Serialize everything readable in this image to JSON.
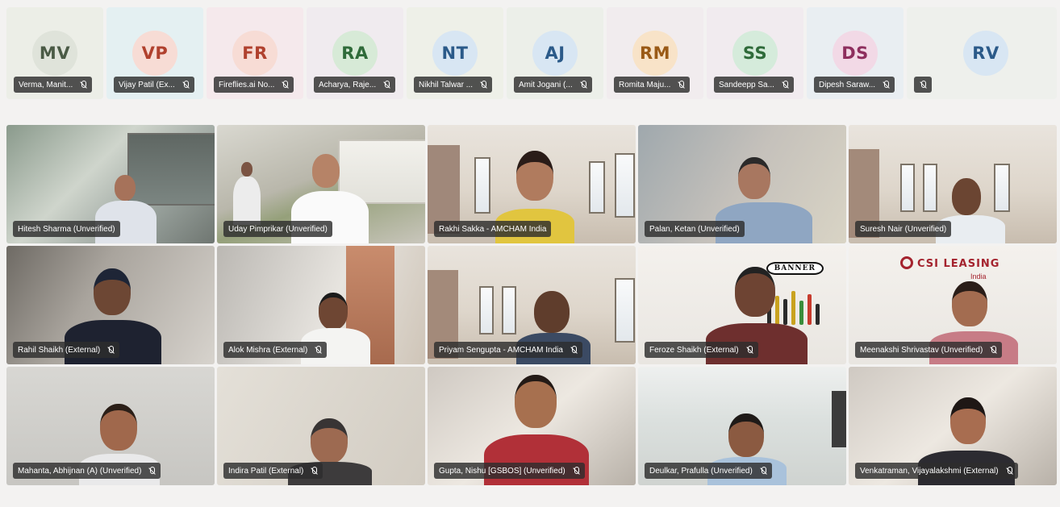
{
  "colors": {
    "label_bg": "#2d2d2d",
    "label_text": "#ffffff",
    "page_bg": "#f3f2f1"
  },
  "audio_tiles": [
    {
      "initials": "MV",
      "name": "Verma, Manit...",
      "tile_bg": "#eceee7",
      "avatar_bg": "#dfe3da",
      "avatar_fg": "#4a5a45"
    },
    {
      "initials": "VP",
      "name": "Vijay Patil (Ex...",
      "tile_bg": "#e4f0f2",
      "avatar_bg": "#f7dcd5",
      "avatar_fg": "#b0412e"
    },
    {
      "initials": "FR",
      "name": "Fireflies.ai No...",
      "tile_bg": "#f5e9ec",
      "avatar_bg": "#f7dcd5",
      "avatar_fg": "#b0412e"
    },
    {
      "initials": "RA",
      "name": "Acharya, Raje...",
      "tile_bg": "#f0ebef",
      "avatar_bg": "#d7ead7",
      "avatar_fg": "#2f6b3a"
    },
    {
      "initials": "NT",
      "name": "Nikhil Talwar ...",
      "tile_bg": "#eef0e8",
      "avatar_bg": "#d8e6f3",
      "avatar_fg": "#2b5a89"
    },
    {
      "initials": "AJ",
      "name": "Amit Jogani (...",
      "tile_bg": "#ecefe9",
      "avatar_bg": "#d8e6f3",
      "avatar_fg": "#2b5a89"
    },
    {
      "initials": "RM",
      "name": "Romita Maju...",
      "tile_bg": "#f1ecee",
      "avatar_bg": "#f8e3c8",
      "avatar_fg": "#9a5a16"
    },
    {
      "initials": "SS",
      "name": "Sandeepp Sa...",
      "tile_bg": "#f1ebef",
      "avatar_bg": "#d5ebdb",
      "avatar_fg": "#2f6b3a"
    },
    {
      "initials": "DS",
      "name": "Dipesh Saraw...",
      "tile_bg": "#e9eef2",
      "avatar_bg": "#f2d9e6",
      "avatar_fg": "#8e2f5e"
    },
    {
      "initials": "RV",
      "name": "",
      "tile_bg": "#eef0ec",
      "avatar_bg": "#d8e6f3",
      "avatar_fg": "#2b5a89"
    }
  ],
  "video_tiles": [
    {
      "name": "Hitesh Sharma (Unverified)",
      "muted": false
    },
    {
      "name": "Uday Pimprikar (Unverified)",
      "muted": false
    },
    {
      "name": "Rakhi Sakka - AMCHAM India",
      "muted": false
    },
    {
      "name": "Palan, Ketan (Unverified)",
      "muted": false
    },
    {
      "name": "Suresh Nair (Unverified)",
      "muted": false
    },
    {
      "name": "Rahil Shaikh (External)",
      "muted": true
    },
    {
      "name": "Alok Mishra (External)",
      "muted": true
    },
    {
      "name": "Priyam Sengupta - AMCHAM India",
      "muted": true
    },
    {
      "name": "Feroze Shaikh (External)",
      "muted": true
    },
    {
      "name": "Meenakshi Shrivastav (Unverified)",
      "muted": true
    },
    {
      "name": "Mahanta, Abhijnan (A) (Unverified)",
      "muted": true
    },
    {
      "name": "Indira Patil (External)",
      "muted": true
    },
    {
      "name": "Gupta, Nishu [GSBOS] (Unverified)",
      "muted": true
    },
    {
      "name": "Deulkar, Prafulla (Unverified)",
      "muted": true
    },
    {
      "name": "Venkatraman, Vijayalakshmi (External)",
      "muted": true
    }
  ],
  "backgrounds": {
    "banner_logo": "BANNER",
    "csi_logo": "CSI LEASING",
    "csi_sub": "India"
  },
  "icons": {
    "muted_mic": "mic-off-icon"
  }
}
